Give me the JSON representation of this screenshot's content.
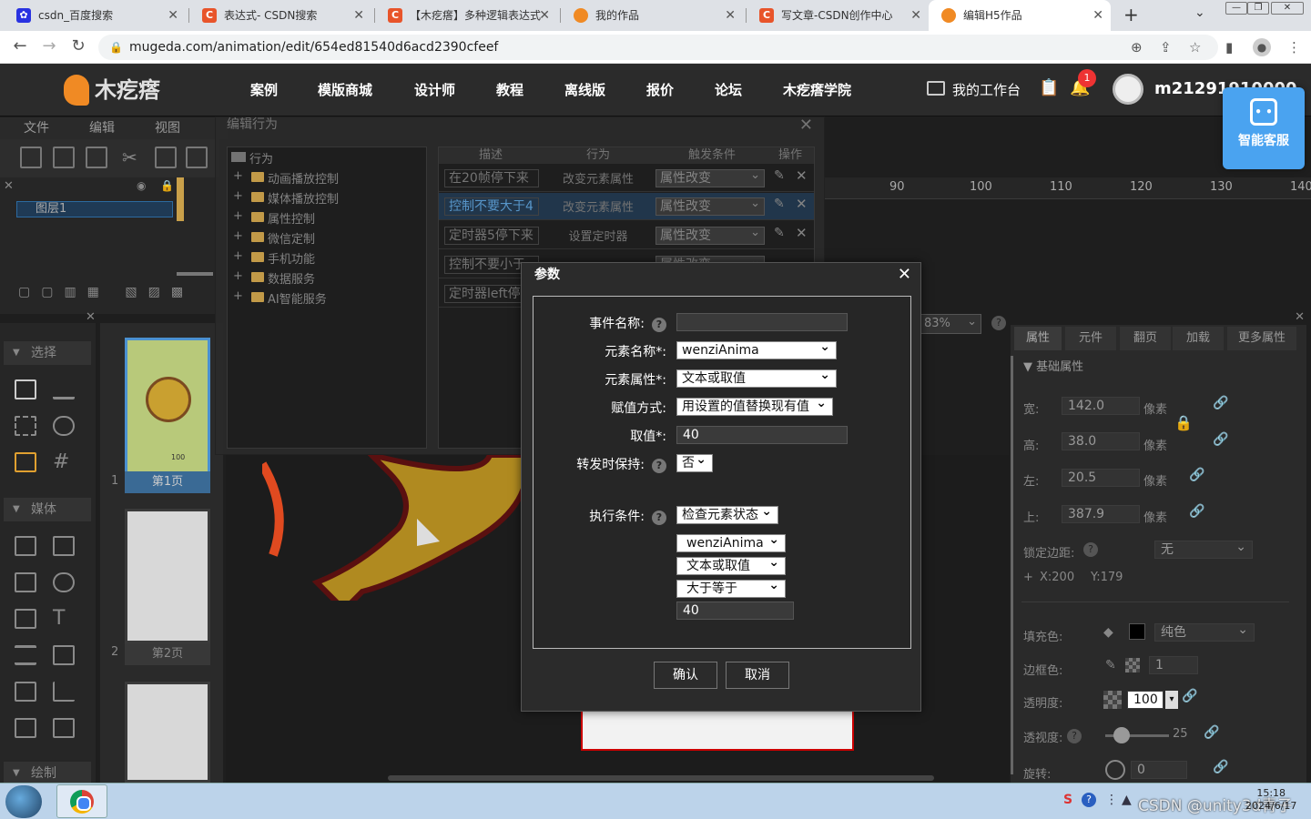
{
  "browser": {
    "tabs": [
      {
        "label": "csdn_百度搜索",
        "icon": "baidu-icon"
      },
      {
        "label": "表达式- CSDN搜索",
        "icon": "csdn-icon"
      },
      {
        "label": "【木疙瘩】多种逻辑表达式",
        "icon": "csdn-icon"
      },
      {
        "label": "我的作品",
        "icon": "mugeda-icon"
      },
      {
        "label": "写文章-CSDN创作中心",
        "icon": "csdn-icon"
      },
      {
        "label": "编辑H5作品",
        "icon": "mugeda-icon"
      }
    ],
    "url": "mugeda.com/animation/edit/654ed81540d6acd2390cfeef"
  },
  "site": {
    "logo_text": "木疙瘩",
    "nav": [
      "案例",
      "模版商城",
      "设计师",
      "教程",
      "离线版",
      "报价",
      "论坛",
      "木疙瘩学院"
    ],
    "workbench": "我的工作台",
    "notification_count": "1",
    "username": "m21291910000",
    "service_label": "智能客服"
  },
  "editor": {
    "menu": [
      "文件",
      "编辑",
      "视图"
    ],
    "layer_name": "图层1",
    "ruler": [
      "90",
      "100",
      "110",
      "120",
      "130",
      "140"
    ],
    "zoom": "83%",
    "left_sections": [
      "选择",
      "媒体",
      "绘制"
    ],
    "pages": [
      {
        "num": "1",
        "label": "第1页"
      },
      {
        "num": "2",
        "label": "第2页"
      }
    ],
    "page_thumb_text": "100"
  },
  "properties": {
    "tabs": [
      "属性",
      "元件",
      "翻页",
      "加载",
      "更多属性"
    ],
    "section": "基础属性",
    "width_label": "宽:",
    "width": "142.0",
    "height_label": "高:",
    "height": "38.0",
    "left_label": "左:",
    "left": "20.5",
    "top_label": "上:",
    "top": "387.9",
    "unit": "像素",
    "lock_edge_label": "锁定边距:",
    "lock_edge": "无",
    "x_label": "X:200",
    "y_label": "Y:179",
    "fill_label": "填充色:",
    "fill_type": "纯色",
    "stroke_label": "边框色:",
    "stroke_width": "1",
    "opacity_label": "透明度:",
    "opacity": "100",
    "perspective_label": "透视度:",
    "perspective": "25",
    "rotate_label": "旋转:",
    "rotate": "0"
  },
  "behavior_dialog": {
    "title": "编辑行为",
    "tree_root": "行为",
    "tree_items": [
      "动画播放控制",
      "媒体播放控制",
      "属性控制",
      "微信定制",
      "手机功能",
      "数据服务",
      "AI智能服务"
    ],
    "columns": [
      "描述",
      "行为",
      "触发条件",
      "操作"
    ],
    "rows": [
      {
        "desc": "在20帧停下来",
        "action": "改变元素属性",
        "trigger": "属性改变"
      },
      {
        "desc": "控制不要大于4",
        "action": "改变元素属性",
        "trigger": "属性改变"
      },
      {
        "desc": "定时器5停下来",
        "action": "设置定时器",
        "trigger": "属性改变"
      },
      {
        "desc": "控制不要小于",
        "action": "",
        "trigger": "属性改变"
      },
      {
        "desc": "定时器left停",
        "action": "",
        "trigger": ""
      }
    ]
  },
  "params_dialog": {
    "title": "参数",
    "event_name_label": "事件名称:",
    "event_name": "",
    "element_name_label": "元素名称*:",
    "element_name": "wenziAnima",
    "element_prop_label": "元素属性*:",
    "element_prop": "文本或取值",
    "assign_label": "赋值方式:",
    "assign": "用设置的值替换现有值",
    "value_label": "取值*:",
    "value": "40",
    "keep_label": "转发时保持:",
    "keep": "否",
    "cond_label": "执行条件:",
    "cond": "检查元素状态",
    "cond_element": "wenziAnima",
    "cond_prop": "文本或取值",
    "cond_op": "大于等于",
    "cond_value": "40",
    "ok": "确认",
    "cancel": "取消"
  },
  "taskbar": {
    "watermark": "CSDN @unity3d青子",
    "time": "15:18",
    "date": "2024/6/17"
  }
}
